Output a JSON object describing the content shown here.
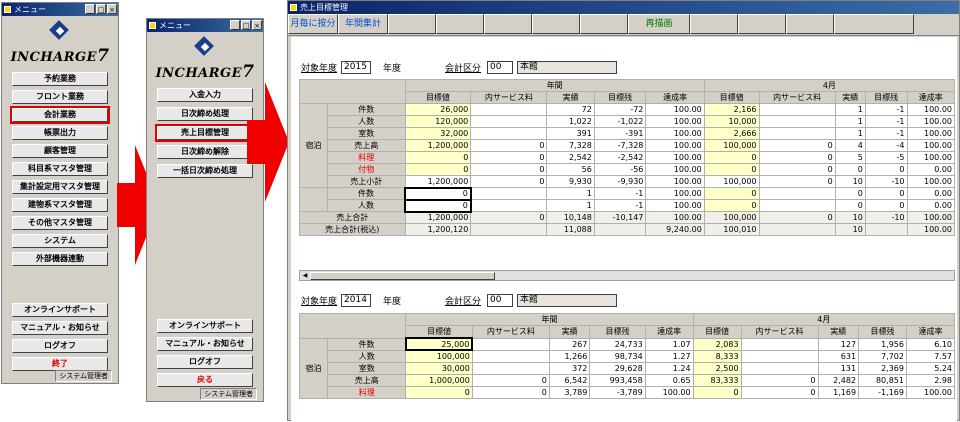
{
  "win1": {
    "title": "メニュー",
    "logo_text": "INCHARGE",
    "logo_num": "7",
    "items": [
      "予約業務",
      "フロント業務",
      "会計業務",
      "帳票出力",
      "顧客管理",
      "科目系マスタ管理",
      "集計設定用マスタ管理",
      "建物系マスタ管理",
      "その他マスタ管理",
      "システム",
      "外部機器連動"
    ],
    "lower": [
      "オンラインサポート",
      "マニュアル・お知らせ",
      "ログオフ",
      "終了"
    ],
    "status": "システム管理者"
  },
  "win2": {
    "title": "メニュー",
    "logo_text": "INCHARGE",
    "logo_num": "7",
    "items": [
      "入金入力",
      "日次締め処理",
      "売上目標管理",
      "日次締め解除",
      "一括日次締め処理"
    ],
    "lower": [
      "オンラインサポート",
      "マニュアル・お知らせ",
      "ログオフ",
      "戻る"
    ],
    "status": "システム管理者"
  },
  "main": {
    "title": "売上目標管理",
    "toolbar": [
      "月毎に按分",
      "年間集計",
      "",
      "",
      "",
      "",
      "",
      "再描画",
      "",
      "",
      "",
      ""
    ],
    "s1": {
      "year_label": "対象年度",
      "year": "2015",
      "year_unit": "年度",
      "acct_label": "会計区分",
      "acct": "00",
      "acct_name": "本館"
    },
    "s2": {
      "year_label": "対象年度",
      "year": "2014",
      "year_unit": "年度",
      "acct_label": "会計区分",
      "acct": "00",
      "acct_name": "本館"
    },
    "period1": "年間",
    "period2": "4月",
    "cols": [
      "目標値",
      "内サービス料",
      "実績",
      "目標残",
      "達成率",
      "目標値",
      "内サービス料",
      "実績",
      "目標残",
      "達成率"
    ],
    "group": "宿泊",
    "t1": [
      {
        "l": "件数",
        "v": [
          "26,000",
          "",
          "72",
          "-72",
          "100.00",
          "2,166",
          "",
          "1",
          "-1",
          "100.00"
        ]
      },
      {
        "l": "人数",
        "v": [
          "120,000",
          "",
          "1,022",
          "-1,022",
          "100.00",
          "10,000",
          "",
          "1",
          "-1",
          "100.00"
        ]
      },
      {
        "l": "室数",
        "v": [
          "32,000",
          "",
          "391",
          "-391",
          "100.00",
          "2,666",
          "",
          "1",
          "-1",
          "100.00"
        ]
      },
      {
        "l": "売上高",
        "v": [
          "1,200,000",
          "0",
          "7,328",
          "-7,328",
          "100.00",
          "100,000",
          "0",
          "4",
          "-4",
          "100.00"
        ]
      },
      {
        "l": "料理",
        "r": true,
        "v": [
          "0",
          "0",
          "2,542",
          "-2,542",
          "100.00",
          "0",
          "0",
          "5",
          "-5",
          "100.00"
        ]
      },
      {
        "l": "付物",
        "r": true,
        "v": [
          "0",
          "0",
          "56",
          "-56",
          "100.00",
          "0",
          "0",
          "0",
          "0",
          "0.00"
        ]
      },
      {
        "l": "売上小計",
        "v": [
          "1,200,000",
          "0",
          "9,930",
          "-9,930",
          "100.00",
          "100,000",
          "0",
          "10",
          "-10",
          "100.00"
        ]
      },
      {
        "l": "件数",
        "v": [
          "0",
          "",
          "1",
          "-1",
          "100.00",
          "0",
          "",
          "0",
          "0",
          "0.00"
        ]
      },
      {
        "l": "人数",
        "v": [
          "0",
          "",
          "1",
          "-1",
          "100.00",
          "0",
          "",
          "0",
          "0",
          "0.00"
        ]
      }
    ],
    "total": {
      "l": "売上合計",
      "v": [
        "1,200,000",
        "0",
        "10,148",
        "-10,147",
        "100.00",
        "100,000",
        "0",
        "10",
        "-10",
        "100.00"
      ]
    },
    "total_tax": {
      "l": "売上合計(税込)",
      "v": [
        "1,200,120",
        "",
        "11,088",
        "",
        "9,240.00",
        "100,010",
        "",
        "10",
        "",
        "100.00"
      ]
    },
    "t2": [
      {
        "l": "件数",
        "v": [
          "25,000",
          "",
          "267",
          "24,733",
          "1.07",
          "2,083",
          "",
          "127",
          "1,956",
          "6.10"
        ]
      },
      {
        "l": "人数",
        "v": [
          "100,000",
          "",
          "1,266",
          "98,734",
          "1.27",
          "8,333",
          "",
          "631",
          "7,702",
          "7.57"
        ]
      },
      {
        "l": "室数",
        "v": [
          "30,000",
          "",
          "372",
          "29,628",
          "1.24",
          "2,500",
          "",
          "131",
          "2,369",
          "5.24"
        ]
      },
      {
        "l": "売上高",
        "v": [
          "1,000,000",
          "0",
          "6,542",
          "993,458",
          "0.65",
          "83,333",
          "0",
          "2,482",
          "80,851",
          "2.98"
        ]
      },
      {
        "l": "料理",
        "r": true,
        "v": [
          "0",
          "0",
          "3,789",
          "-3,789",
          "100.00",
          "0",
          "0",
          "1,169",
          "-1,169",
          "100.00"
        ]
      }
    ]
  }
}
